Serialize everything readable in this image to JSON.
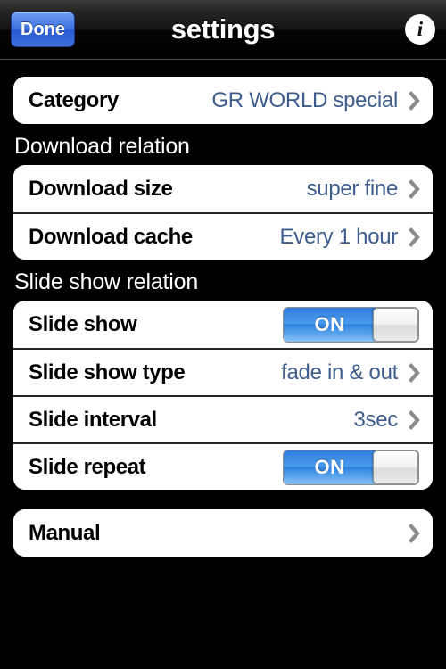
{
  "navbar": {
    "done_label": "Done",
    "title": "settings",
    "info_glyph": "i",
    "info_icon_name": "info-icon"
  },
  "colors": {
    "background": "#000000",
    "card": "#ffffff",
    "label": "#000000",
    "value": "#3f5d8c",
    "chevron": "#8c8c8c",
    "switch_on": "#3f8fe8",
    "done_button": "#3f72e0"
  },
  "sections": [
    {
      "header": "",
      "rows": [
        {
          "label": "Category",
          "value": "GR WORLD special",
          "accessory": "chevron"
        }
      ]
    },
    {
      "header": "Download relation",
      "rows": [
        {
          "label": "Download size",
          "value": "super fine",
          "accessory": "chevron"
        },
        {
          "label": "Download cache",
          "value": "Every 1 hour",
          "accessory": "chevron"
        }
      ]
    },
    {
      "header": "Slide show relation",
      "rows": [
        {
          "label": "Slide show",
          "value": "",
          "accessory": "switch",
          "switch_state": "ON"
        },
        {
          "label": "Slide show type",
          "value": "fade in & out",
          "accessory": "chevron"
        },
        {
          "label": "Slide interval",
          "value": "3sec",
          "accessory": "chevron"
        },
        {
          "label": "Slide repeat",
          "value": "",
          "accessory": "switch",
          "switch_state": "ON"
        }
      ]
    },
    {
      "header": "",
      "rows": [
        {
          "label": "Manual",
          "value": "",
          "accessory": "chevron"
        }
      ]
    }
  ]
}
